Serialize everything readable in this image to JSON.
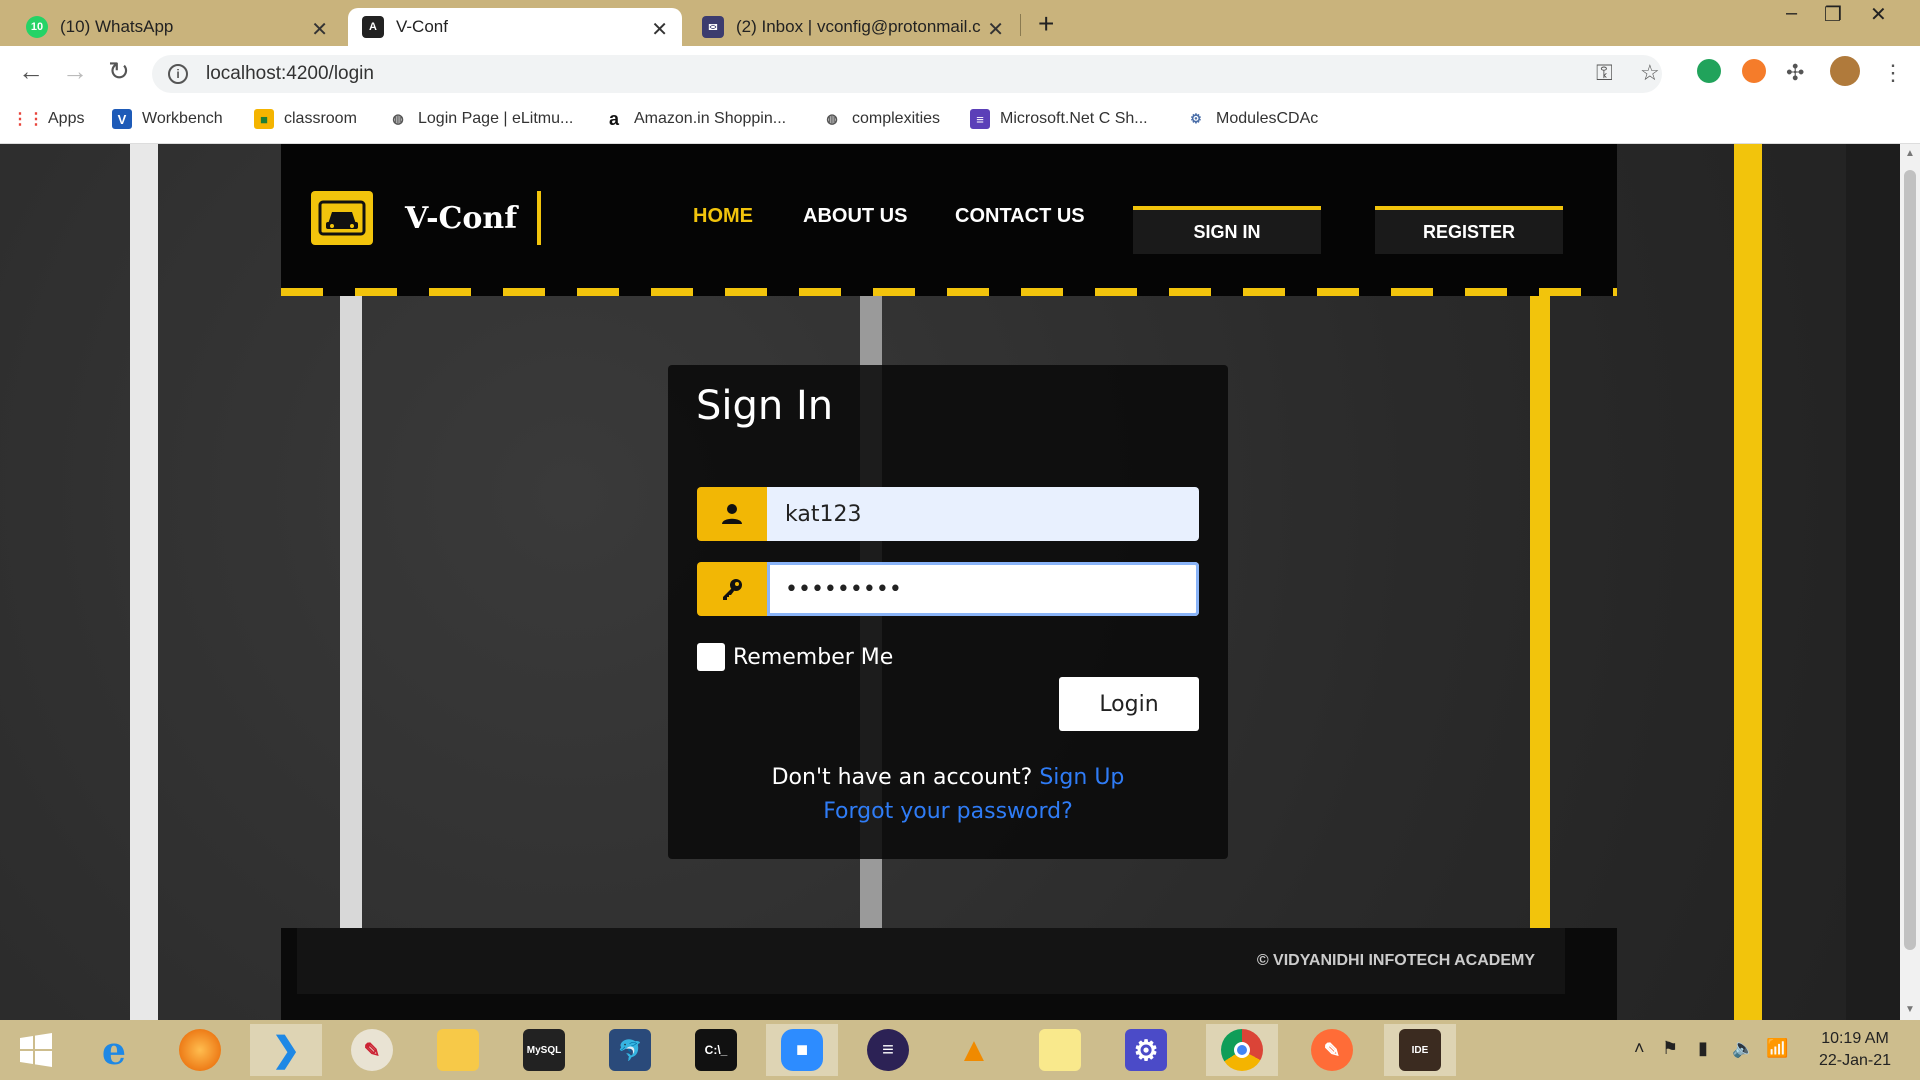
{
  "browser": {
    "tabs": [
      {
        "title": "(10) WhatsApp",
        "badge": "10",
        "active": false
      },
      {
        "title": "V-Conf",
        "active": true
      },
      {
        "title": "(2) Inbox | vconfig@protonmail.c",
        "active": false
      }
    ],
    "url": "localhost:4200/login",
    "bookmarks": [
      {
        "label": "Apps",
        "icon": "apps-grid-icon"
      },
      {
        "label": "Workbench",
        "icon": "v-icon"
      },
      {
        "label": "classroom",
        "icon": "classroom-icon"
      },
      {
        "label": "Login Page | eLitmu...",
        "icon": "globe-icon"
      },
      {
        "label": "Amazon.in Shoppin...",
        "icon": "amazon-icon"
      },
      {
        "label": "complexities",
        "icon": "globe-icon"
      },
      {
        "label": "Microsoft.Net C Sh...",
        "icon": "list-icon"
      },
      {
        "label": "ModulesCDAc",
        "icon": "modules-icon"
      }
    ]
  },
  "site": {
    "logo_text": "V-Conf",
    "nav": {
      "home": "HOME",
      "about": "ABOUT US",
      "contact": "CONTACT US",
      "sign_in": "SIGN IN",
      "register": "REGISTER"
    },
    "footer": "© VIDYANIDHI INFOTECH ACADEMY"
  },
  "login": {
    "title": "Sign In",
    "username_value": "kat123",
    "password_value": "•••••••••",
    "remember_label": "Remember Me",
    "remember_checked": false,
    "login_button": "Login",
    "no_account_text": "Don't have an account?",
    "signup_link": "Sign Up",
    "forgot_link": "Forgot your password?"
  },
  "taskbar": {
    "time": "10:19 AM",
    "date": "22-Jan-21"
  },
  "colors": {
    "accent": "#f2c40c",
    "link": "#2f7cf6",
    "chrome_frame": "#c9b37c"
  }
}
